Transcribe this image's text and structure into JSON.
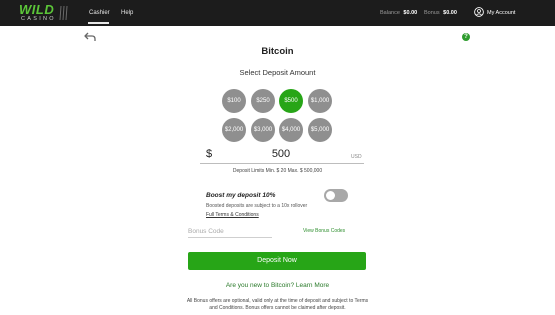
{
  "header": {
    "logo": {
      "word": "WILD",
      "sub": "CASINO"
    },
    "nav": [
      {
        "label": "Cashier",
        "active": true
      },
      {
        "label": "Help",
        "active": false
      }
    ],
    "balance_label": "Balance",
    "balance_value": "$0.00",
    "bonus_label": "Bonus",
    "bonus_value": "$0.00",
    "account_label": "My Account",
    "account_icon": "user-circle-icon"
  },
  "page": {
    "back_icon": "back-arrow-icon",
    "help_icon": "?",
    "title": "Bitcoin",
    "subtitle": "Select Deposit Amount"
  },
  "amounts": [
    {
      "label": "$100",
      "selected": false
    },
    {
      "label": "$250",
      "selected": false
    },
    {
      "label": "$500",
      "selected": true
    },
    {
      "label": "$1,000",
      "selected": false
    },
    {
      "label": "$2,000",
      "selected": false
    },
    {
      "label": "$3,000",
      "selected": false
    },
    {
      "label": "$4,000",
      "selected": false
    },
    {
      "label": "$5,000",
      "selected": false
    }
  ],
  "amount_field": {
    "currency_symbol": "$",
    "value": "500",
    "unit": "USD",
    "limits": "Deposit Limits  Min. $ 20    Max. $ 500,000"
  },
  "boost": {
    "title": "Boost my deposit 10%",
    "description": "Boosted deposits are subject to a 10x rollover",
    "terms_link": "Full Terms & Conditions",
    "enabled": false
  },
  "bonus": {
    "placeholder": "Bonus Code",
    "value": "",
    "view_codes": "View Bonus Codes"
  },
  "deposit_button": "Deposit Now",
  "learn_more": {
    "question": "Are you new to Bitcoin?",
    "link": "Learn More"
  },
  "disclaimer": "All Bonus offers are optional, valid only at the time of deposit and subject to Terms and Conditions. Bonus offers cannot be claimed after deposit.",
  "colors": {
    "topbar": "#1c1c1c",
    "brand_green": "#27a517",
    "logo_green": "#5cc639",
    "chip_gray": "#8f8f8f",
    "link_green": "#2f8f2f"
  }
}
